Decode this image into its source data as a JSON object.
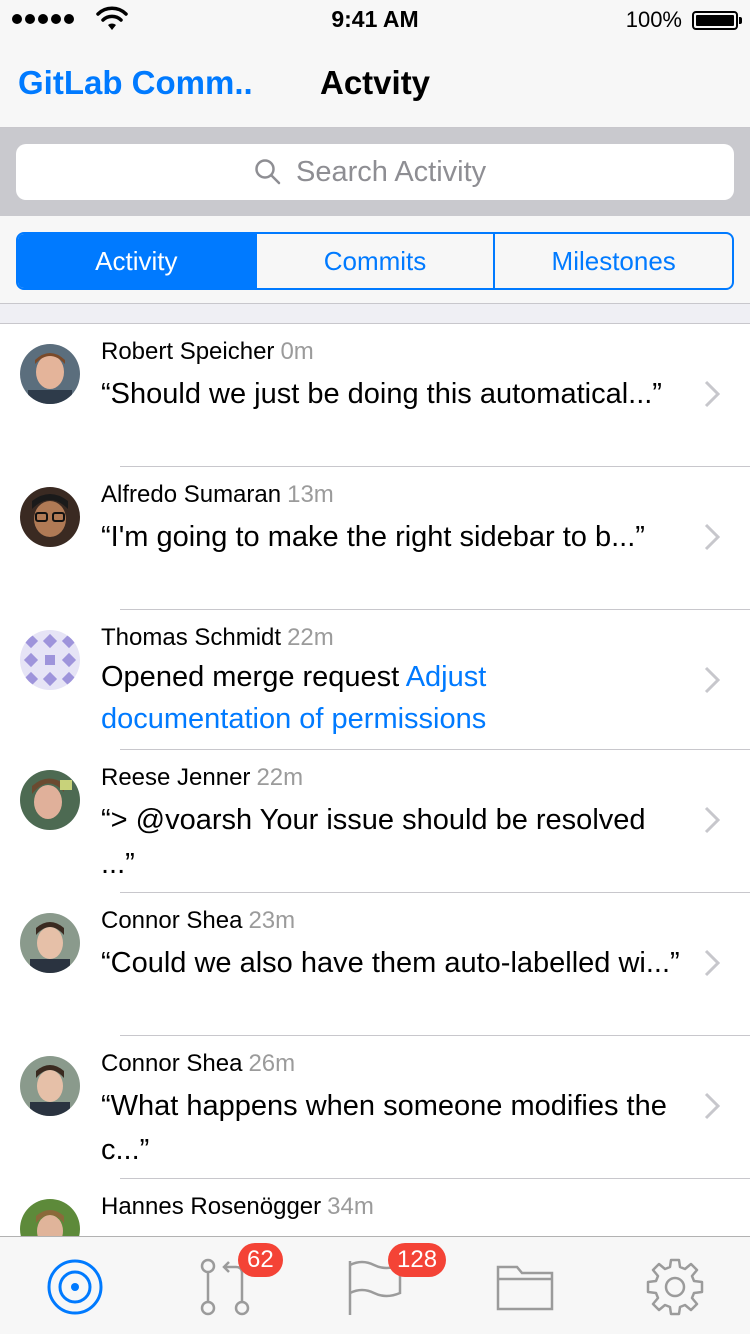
{
  "status_bar": {
    "time": "9:41 AM",
    "battery": "100%"
  },
  "nav": {
    "back_label": "GitLab Comm..",
    "title": "Actvity"
  },
  "search": {
    "placeholder": "Search Activity"
  },
  "segments": [
    {
      "label": "Activity",
      "active": true
    },
    {
      "label": "Commits",
      "active": false
    },
    {
      "label": "Milestones",
      "active": false
    }
  ],
  "activity": [
    {
      "author": "Robert Speicher",
      "time": "0m",
      "text": "“Should we just be doing this automatical...”"
    },
    {
      "author": "Alfredo Sumaran",
      "time": "13m",
      "text": "“I'm going to make the right sidebar to b...”"
    },
    {
      "author": "Thomas Schmidt",
      "time": "22m",
      "prefix": "Opened merge request ",
      "link": "Adjust documentation of permissions"
    },
    {
      "author": "Reese Jenner",
      "time": "22m",
      "text": "“> @voarsh Your issue should be resolved ...”"
    },
    {
      "author": "Connor Shea",
      "time": "23m",
      "text": "“Could we also have them auto-labelled wi...”"
    },
    {
      "author": "Connor Shea",
      "time": "26m",
      "text": "“What happens when someone modifies the c...”"
    },
    {
      "author": "Hannes Rosenögger",
      "time": "34m",
      "text": "“"
    }
  ],
  "tabbar": {
    "merge_requests_badge": "62",
    "issues_badge": "128"
  },
  "colors": {
    "accent": "#007aff",
    "badge": "#f44336"
  }
}
